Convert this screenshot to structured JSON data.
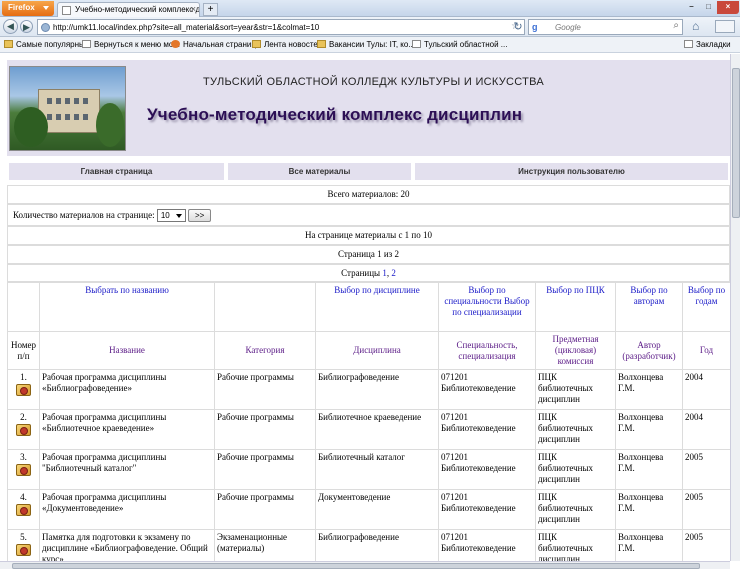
{
  "browser": {
    "app_button": "Firefox",
    "tab_title": "Учебно-методический комплекс дисц...",
    "new_tab": "+",
    "url": "http://umk11.local/index.php?site=all_material&sort=year&str=1&colmat=10",
    "search_placeholder": "Google",
    "search_engine_glyph": "g",
    "bookmarks": [
      {
        "label": "Самые популярные",
        "icon": "folder-icon"
      },
      {
        "label": "Вернуться к меню мо...",
        "icon": "page-icon"
      },
      {
        "label": "Начальная страница",
        "icon": "firefox-icon"
      },
      {
        "label": "Лента новостей",
        "icon": "folder-icon"
      },
      {
        "label": "Вакансии Тулы: IT, ко...",
        "icon": "folder-icon"
      },
      {
        "label": "Тульский областной ...",
        "icon": "page-icon"
      }
    ],
    "bookmarks_menu": "Закладки"
  },
  "header": {
    "college": "ТУЛЬСКИЙ ОБЛАСТНОЙ КОЛЛЕДЖ КУЛЬТУРЫ И ИСКУССТВА",
    "title": "Учебно-методический комплекс дисциплин"
  },
  "menu": {
    "home": "Главная страница",
    "all": "Все материалы",
    "guide": "Инструкция пользователю"
  },
  "summary": {
    "total": "Всего материалов: 20",
    "per_page_label": "Количество материалов на странице:",
    "per_page_value": "10",
    "go_button": ">>",
    "range": "На странице материалы с 1 по 10",
    "page_of": "Страница 1 из 2",
    "pages_label": "Страницы",
    "page_links": [
      "1",
      "2"
    ]
  },
  "filters": {
    "name": "Выбрать по названию",
    "discipline": "Выбор по дисциплине",
    "specialty": "Выбор по специальности Выбор по специализации",
    "pck": "Выбор по ПЦК",
    "author": "Выбор по авторам",
    "year": "Выбор по годам"
  },
  "columns": {
    "num": "Номер п/п",
    "name": "Название",
    "category": "Категория",
    "discipline": "Дисциплина",
    "specialty": "Специальность, специализация",
    "pck": "Предметная (цикловая) комиссия",
    "author": "Автор (разработчик)",
    "year": "Год"
  },
  "rows": [
    {
      "num": "1.",
      "name": "Рабочая программа дисциплины «Библиографоведение»",
      "category": "Рабочие программы",
      "discipline": "Библиографоведение",
      "specialty": "071201 Библиотековедение",
      "pck": "ПЦК библиотечных дисциплин",
      "author": "Волхонцева Г.М.",
      "year": "2004"
    },
    {
      "num": "2.",
      "name": "Рабочая программа дисциплины «Библиотечное краеведение»",
      "category": "Рабочие программы",
      "discipline": "Библиотечное краеведение",
      "specialty": "071201 Библиотековедение",
      "pck": "ПЦК библиотечных дисциплин",
      "author": "Волхонцева Г.М.",
      "year": "2004"
    },
    {
      "num": "3.",
      "name": "Рабочая программа дисциплины \"Библиотечный каталог\"",
      "category": "Рабочие программы",
      "discipline": "Библиотечный каталог",
      "specialty": "071201 Библиотековедение",
      "pck": "ПЦК библиотечных дисциплин",
      "author": "Волхонцева Г.М.",
      "year": "2005"
    },
    {
      "num": "4.",
      "name": "Рабочая программа дисциплины «Документоведение»",
      "category": "Рабочие программы",
      "discipline": "Документоведение",
      "specialty": "071201 Библиотековедение",
      "pck": "ПЦК библиотечных дисциплин",
      "author": "Волхонцева Г.М.",
      "year": "2005"
    },
    {
      "num": "5.",
      "name": "Памятка для подготовки к экзамену по дисциплине «Библиографоведение. Общий курс»",
      "category": "Экзаменационные (материалы)",
      "discipline": "Библиографоведение",
      "specialty": "071201 Библиотековедение",
      "pck": "ПЦК библиотечных дисциплин",
      "author": "Волхонцева Г.М.",
      "year": "2005"
    }
  ]
}
